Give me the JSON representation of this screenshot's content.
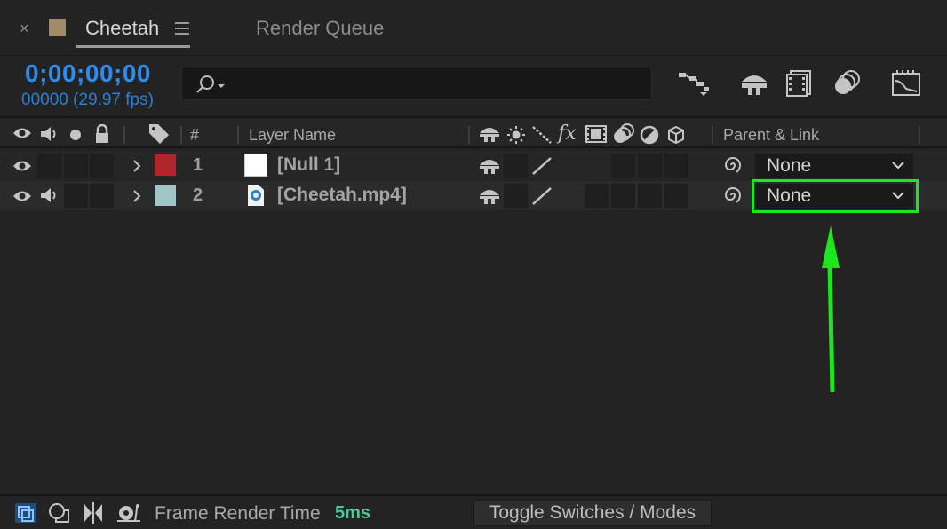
{
  "tabs": {
    "active": "Cheetah",
    "other": "Render Queue",
    "close_glyph": "×",
    "swatch_color": "#a08a6a"
  },
  "timecode": {
    "value": "0;00;00;00",
    "frames": "00000 (29.97 fps)"
  },
  "search": {
    "placeholder": ""
  },
  "toolbar_icons": [
    "comp-flowchart-icon",
    "draft-3d-icon",
    "frame-blending-icon",
    "motion-blur-icon",
    "graph-editor-icon"
  ],
  "header": {
    "number": "#",
    "layer_name": "Layer Name",
    "parent_link": "Parent & Link",
    "fx": "fx"
  },
  "layers": [
    {
      "num": "1",
      "name": "[Null 1]",
      "label_color": "#b1262b",
      "parent": "None",
      "has_audio": false
    },
    {
      "num": "2",
      "name": "[Cheetah.mp4]",
      "label_color": "#9fc7c5",
      "parent": "None",
      "has_audio": true
    }
  ],
  "footer": {
    "frame_render_label": "Frame Render Time",
    "frame_render_value": "5ms",
    "toggle_label": "Toggle Switches / Modes"
  },
  "annotation": {
    "highlight_color": "#1ce61c",
    "target": "layer 2 parent dropdown"
  }
}
